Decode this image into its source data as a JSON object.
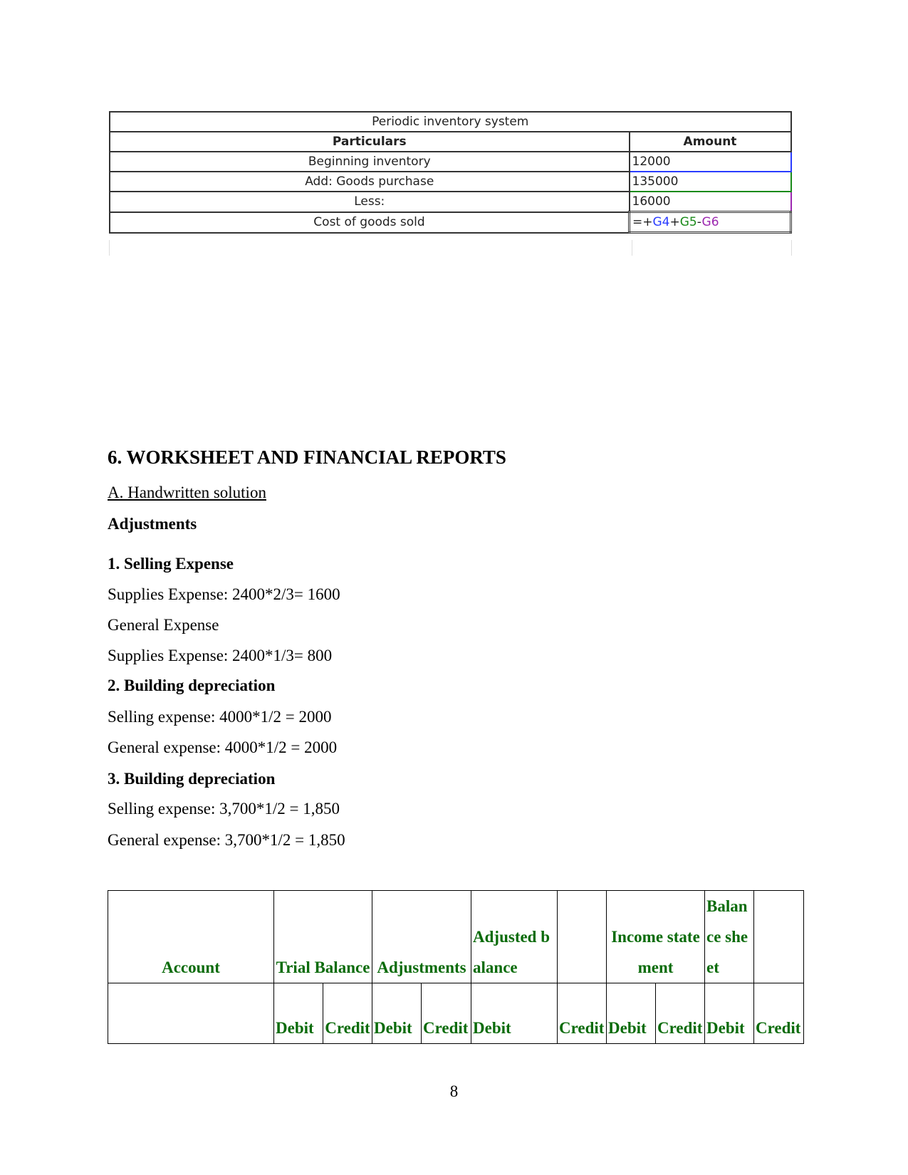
{
  "spreadsheet": {
    "title": "Periodic inventory system",
    "headers": [
      "Particulars",
      "Amount"
    ],
    "rows": [
      {
        "particular": "Beginning inventory",
        "amount": "12000"
      },
      {
        "particular": "Add: Goods purchase",
        "amount": "135000"
      },
      {
        "particular": "Less:",
        "amount": "16000"
      },
      {
        "particular": "Cost of goods sold",
        "formula_parts": [
          "=+",
          "G4",
          "+",
          "G5",
          "-",
          "G6"
        ]
      }
    ],
    "colors": {
      "G4": "#2a3cff",
      "G5": "#1a8a1a",
      "G6": "#9c27b0"
    }
  },
  "section": {
    "heading": "6. WORKSHEET AND FINANCIAL REPORTS",
    "subheading": "A. Handwritten solution",
    "adjustments_label": "Adjustments",
    "lines": [
      {
        "text": "1. Selling Expense",
        "bold": true
      },
      {
        "text": "Supplies Expense: 2400*2/3= 1600",
        "bold": false
      },
      {
        "text": "General Expense",
        "bold": false
      },
      {
        "text": "Supplies Expense: 2400*1/3= 800",
        "bold": false
      },
      {
        "text": "2. Building depreciation",
        "bold": true
      },
      {
        "text": "Selling expense: 4000*1/2 = 2000",
        "bold": false
      },
      {
        "text": "General expense: 4000*1/2 = 2000",
        "bold": false
      },
      {
        "text": "3. Building depreciation",
        "bold": true
      },
      {
        "text": "Selling expense: 3,700*1/2 = 1,850",
        "bold": false
      },
      {
        "text": "General expense: 3,700*1/2 = 1,850",
        "bold": false
      }
    ]
  },
  "worksheet": {
    "text_color": "#0a6b0a",
    "header_row": [
      "Account",
      "Trial Balance",
      "Adjustments",
      "Adjusted balance",
      "",
      "Income statement",
      "Balance sheet",
      ""
    ],
    "sub_row": [
      "",
      "Debit",
      "Credit",
      "Debit",
      "Credit",
      "Debit",
      "Credit",
      "Debit",
      "Credit",
      "Debit",
      "Credit"
    ]
  },
  "page_number": "8"
}
